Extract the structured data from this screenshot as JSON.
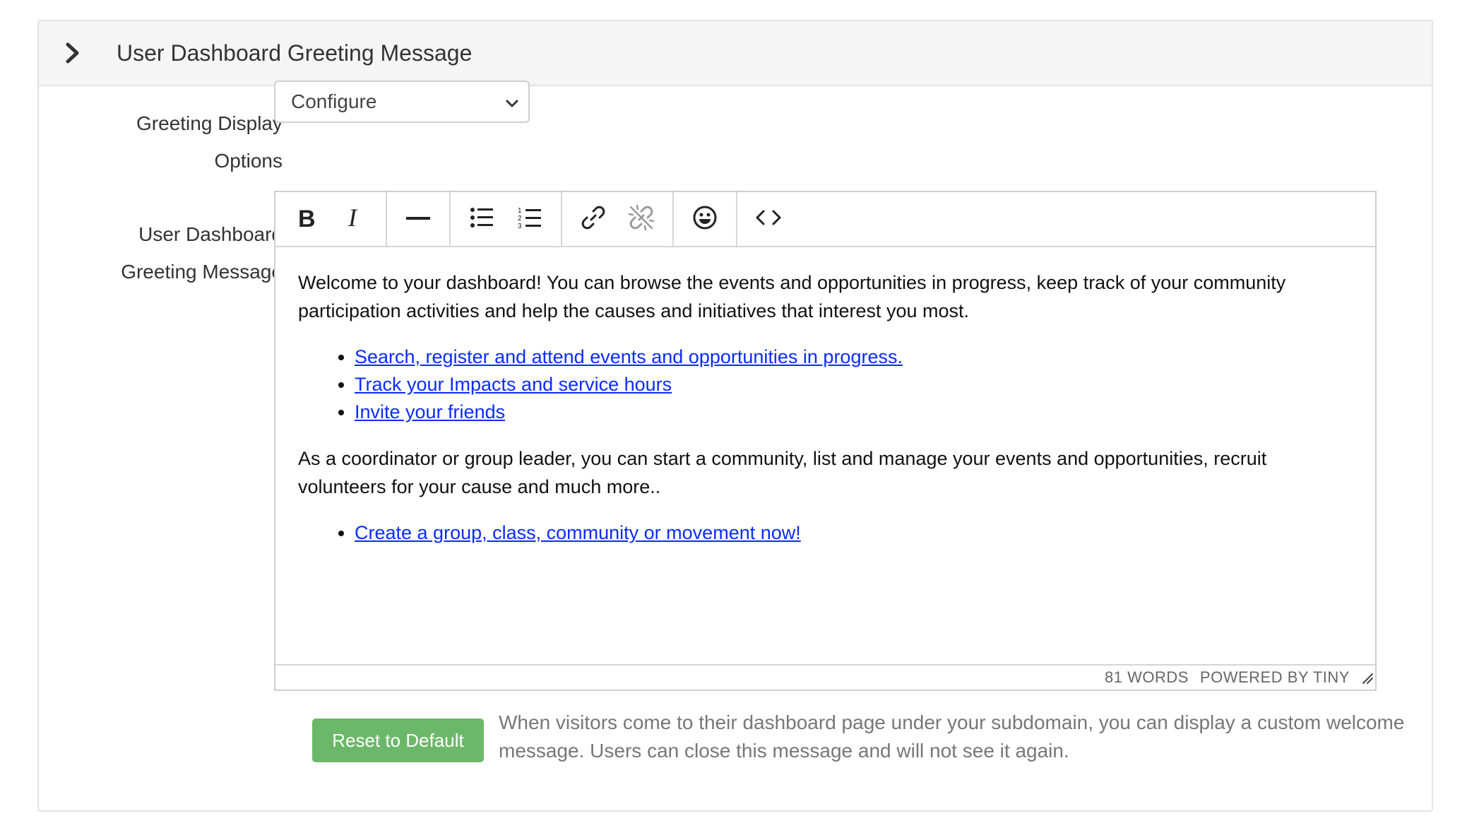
{
  "panel": {
    "title": "User Dashboard Greeting Message"
  },
  "display_options": {
    "label_line1": "Greeting Display",
    "label_line2": "Options",
    "selected": "Configure"
  },
  "greeting_field": {
    "label_line1": "User Dashboard",
    "label_line2": "Greeting Message"
  },
  "toolbar": {
    "icons": [
      "bold-icon",
      "italic-icon",
      "horizontal-rule-icon",
      "bullet-list-icon",
      "numbered-list-icon",
      "link-icon",
      "unlink-icon",
      "emoticon-icon",
      "source-code-icon"
    ]
  },
  "editor": {
    "paragraph1": "Welcome to your dashboard! You can browse the events and opportunities in progress, keep track of your community participation activities and help the causes and initiatives that interest you most.",
    "links1": [
      "Search, register and attend events and opportunities in progress.",
      "Track your Impacts and service hours",
      "Invite your friends"
    ],
    "paragraph2": "As a coordinator or group leader, you can start a community, list and manage your events and opportunities, recruit volunteers for your cause and much more..",
    "links2": [
      "Create a group, class, community or movement now!"
    ],
    "word_count": "81 WORDS",
    "powered_by": "POWERED BY TINY"
  },
  "reset_button": "Reset to Default",
  "help_text": "When visitors come to their dashboard page under your subdomain, you can display a custom welcome message. Users can close this message and will not see it again.",
  "colors": {
    "link": "#0b2cff",
    "reset_button": "#6cb86a",
    "header_bg": "#f5f5f5"
  }
}
